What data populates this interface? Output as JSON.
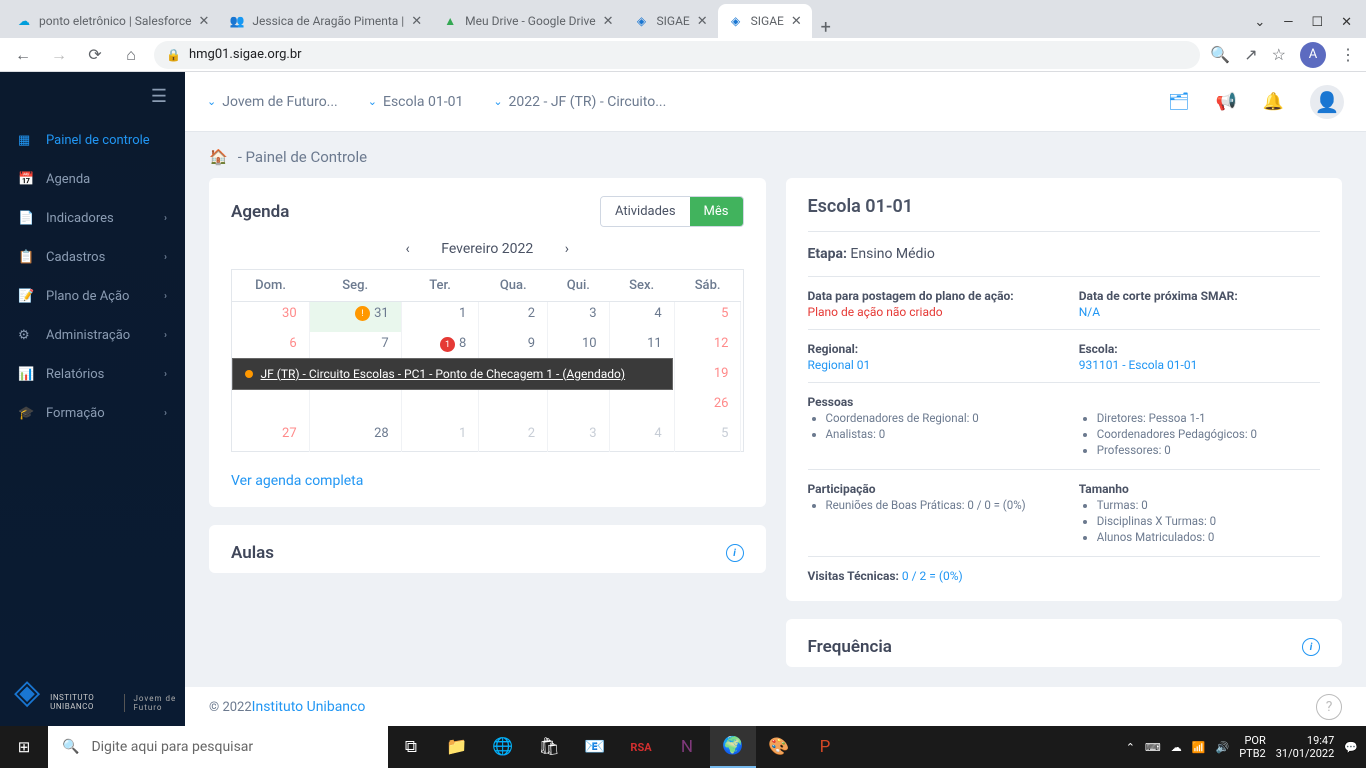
{
  "browser": {
    "tabs": [
      {
        "title": "ponto eletrônico | Salesforce",
        "icon": "☁"
      },
      {
        "title": "Jessica de Aragão Pimenta | ",
        "icon": "👥"
      },
      {
        "title": "Meu Drive - Google Drive",
        "icon": "▲"
      },
      {
        "title": "SIGAE",
        "icon": "◈"
      },
      {
        "title": "SIGAE",
        "icon": "◈",
        "active": true
      }
    ],
    "url": "hmg01.sigae.org.br",
    "avatar": "A"
  },
  "breadcrumbs": {
    "b1": "Jovem de Futuro...",
    "b2": "Escola 01-01",
    "b3": "2022 - JF (TR) - Circuito..."
  },
  "page_header": "- Painel de Controle",
  "sidebar": {
    "items": [
      {
        "label": "Painel de controle",
        "active": true
      },
      {
        "label": "Agenda"
      },
      {
        "label": "Indicadores"
      },
      {
        "label": "Cadastros"
      },
      {
        "label": "Plano de Ação"
      },
      {
        "label": "Administração"
      },
      {
        "label": "Relatórios"
      },
      {
        "label": "Formação"
      }
    ],
    "logo1": "Instituto\nUnibanco",
    "logo2": "Jovem de Futuro"
  },
  "agenda": {
    "title": "Agenda",
    "btn_activities": "Atividades",
    "btn_month": "Mês",
    "month_label": "Fevereiro 2022",
    "weekdays": [
      "Dom.",
      "Seg.",
      "Ter.",
      "Qua.",
      "Qui.",
      "Sex.",
      "Sáb."
    ],
    "rows": [
      [
        {
          "d": "30",
          "muted": true,
          "wknd": true
        },
        {
          "d": "31",
          "today": true,
          "warn": true
        },
        {
          "d": "1"
        },
        {
          "d": "2"
        },
        {
          "d": "3"
        },
        {
          "d": "4"
        },
        {
          "d": "5",
          "wknd": true
        }
      ],
      [
        {
          "d": "6",
          "wknd": true
        },
        {
          "d": "7"
        },
        {
          "d": "8",
          "dot": true
        },
        {
          "d": "9"
        },
        {
          "d": "10"
        },
        {
          "d": "11"
        },
        {
          "d": "12",
          "wknd": true
        }
      ],
      [
        {
          "d": ""
        },
        {
          "d": ""
        },
        {
          "d": ""
        },
        {
          "d": ""
        },
        {
          "d": ""
        },
        {
          "d": ""
        },
        {
          "d": "19",
          "wknd": true
        }
      ],
      [
        {
          "d": ""
        },
        {
          "d": ""
        },
        {
          "d": ""
        },
        {
          "d": ""
        },
        {
          "d": ""
        },
        {
          "d": ""
        },
        {
          "d": "26",
          "wknd": true
        }
      ],
      [
        {
          "d": "27",
          "wknd": true
        },
        {
          "d": "28"
        },
        {
          "d": "1",
          "muted": true
        },
        {
          "d": "2",
          "muted": true
        },
        {
          "d": "3",
          "muted": true
        },
        {
          "d": "4",
          "muted": true
        },
        {
          "d": "5",
          "muted": true
        }
      ]
    ],
    "tooltip": "JF (TR) - Circuito Escolas - PC1 - Ponto de Checagem 1 - (Agendado)",
    "full_agenda_link": "Ver agenda completa"
  },
  "school": {
    "title": "Escola 01-01",
    "etapa_label": "Etapa:",
    "etapa_value": "Ensino Médio",
    "post_plan_label": "Data para postagem do plano de ação:",
    "post_plan_value": "Plano de ação não criado",
    "smar_label": "Data de corte próxima SMAR:",
    "smar_value": "N/A",
    "regional_label": "Regional:",
    "regional_value": "Regional 01",
    "escola_label": "Escola:",
    "escola_value": "931101 - Escola 01-01",
    "pessoas_label": "Pessoas",
    "pessoas_left": [
      "Coordenadores de Regional: 0",
      "Analistas: 0"
    ],
    "pessoas_right": [
      "Diretores: Pessoa 1-1",
      "Coordenadores Pedagógicos: 0",
      "Professores: 0"
    ],
    "participacao_label": "Participação",
    "participacao_items": [
      "Reuniões de Boas Práticas: 0 / 0 = (0%)"
    ],
    "tamanho_label": "Tamanho",
    "tamanho_items": [
      "Turmas: 0",
      "Disciplinas X Turmas: 0",
      "Alunos Matriculados: 0"
    ],
    "visitas_label": "Visitas Técnicas:",
    "visitas_value": "0 / 2 = (0%)"
  },
  "cards": {
    "aulas": "Aulas",
    "frequencia": "Frequência"
  },
  "footer": {
    "copyright": "© 2022 ",
    "link": "Instituto Unibanco"
  },
  "taskbar": {
    "search_placeholder": "Digite aqui para pesquisar",
    "lang": "POR\nPTB2",
    "time": "19:47",
    "date": "31/01/2022"
  }
}
